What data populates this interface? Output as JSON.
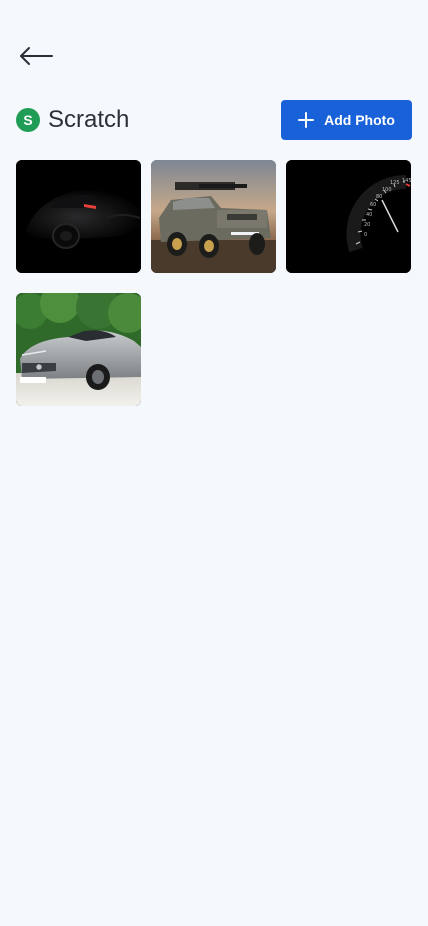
{
  "header": {
    "back_icon": "arrow-left-icon",
    "avatar_letter": "S",
    "title": "Scratch",
    "add_button_label": "Add Photo",
    "add_icon": "plus-icon"
  },
  "colors": {
    "background": "#f5f8fc",
    "accent": "#1861d8",
    "badge": "#1f9d57"
  },
  "photos": [
    {
      "subject": "black sports car in dark"
    },
    {
      "subject": "off-road pickup truck at sunset"
    },
    {
      "subject": "speedometer gauge"
    },
    {
      "subject": "silver sports coupe with trees"
    }
  ]
}
